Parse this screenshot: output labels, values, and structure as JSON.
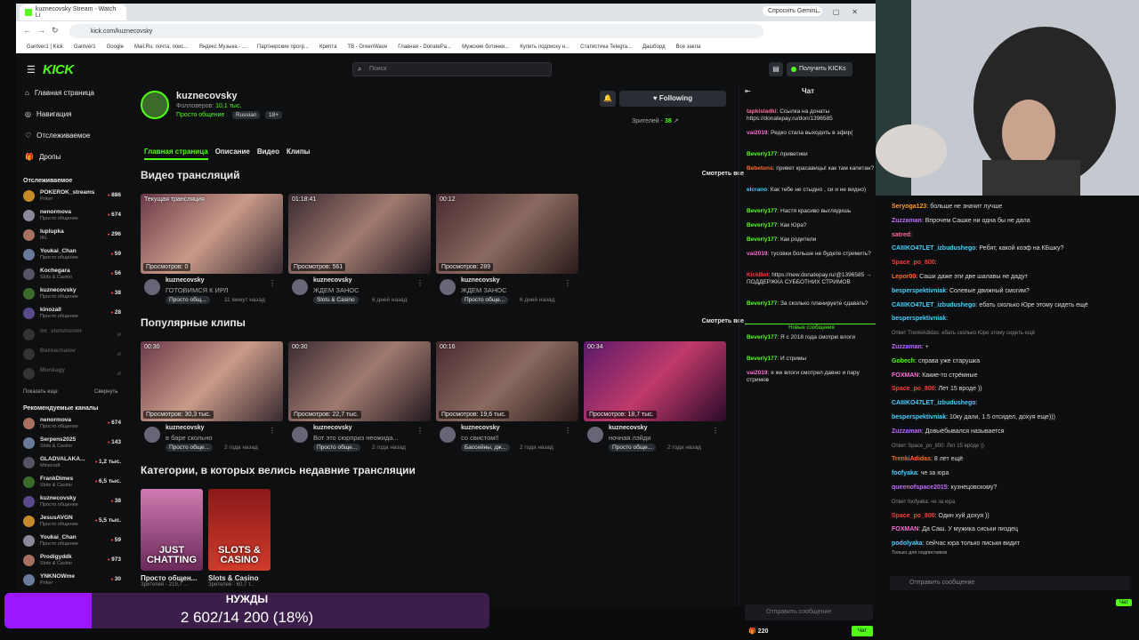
{
  "browser": {
    "tab_title": "kuznecovsky Stream - Watch Li",
    "gemini": "Спросить Gemini",
    "url": "kick.com/kuznecovsky",
    "bookmarks": [
      "Gantver1 | Kick",
      "Gantver1",
      "Google",
      "Mail.Ru: почта, поис...",
      "Яндекс Музыка - ...",
      "Партнерские прогр...",
      "Крипта",
      "TB - GreenWave",
      "Главная - DonatePa...",
      "Мужские ботинки...",
      "Купить подписку н...",
      "Статистика Telegra...",
      "Дашборд",
      "Все закла"
    ]
  },
  "kick": {
    "search_placeholder": "Поиск",
    "kicks_button": "Получить KICKs",
    "nav": [
      {
        "label": "Главная страница",
        "icon": "home-icon"
      },
      {
        "label": "Навигация",
        "icon": "compass-icon"
      },
      {
        "label": "Отслеживаемое",
        "icon": "heart-icon"
      },
      {
        "label": "Дропы",
        "icon": "gift-icon"
      }
    ],
    "followed_title": "Отслеживаемое",
    "followed": [
      {
        "name": "POKEROK_streams",
        "cat": "Poker",
        "viewers": "886"
      },
      {
        "name": "nenormova",
        "cat": "Просто общение",
        "viewers": "674"
      },
      {
        "name": "luplupka",
        "cat": "IRL",
        "viewers": "296"
      },
      {
        "name": "Youkai_Chan",
        "cat": "Просто общение",
        "viewers": "59"
      },
      {
        "name": "Kochegara",
        "cat": "Slots & Casino",
        "viewers": "56"
      },
      {
        "name": "kuznecovsky",
        "cat": "Просто общение",
        "viewers": "38"
      },
      {
        "name": "kinozall",
        "cat": "Просто общение",
        "viewers": "28"
      }
    ],
    "offline": [
      "mr_slotshunter",
      "Beznachalov",
      "Monkagy"
    ],
    "show_more": "Показать еще",
    "collapse": "Свернуть",
    "recommended_title": "Рекомендуемые каналы",
    "recommended": [
      {
        "name": "nenormova",
        "cat": "Просто общение",
        "viewers": "674"
      },
      {
        "name": "Serpens2025",
        "cat": "Slots & Casino",
        "viewers": "143"
      },
      {
        "name": "GLADVALAKA...",
        "cat": "Minecraft",
        "viewers": "1,2 тыс."
      },
      {
        "name": "FrankDimes",
        "cat": "Slots & Casino",
        "viewers": "6,5 тыс."
      },
      {
        "name": "kuznecovsky",
        "cat": "Просто общение",
        "viewers": "38"
      },
      {
        "name": "JesusAVGN",
        "cat": "Просто общение",
        "viewers": "5,5 тыс."
      },
      {
        "name": "Youkai_Chan",
        "cat": "Просто общение",
        "viewers": "59"
      },
      {
        "name": "Prodigyddk",
        "cat": "Slots & Casino",
        "viewers": "973"
      },
      {
        "name": "YNKNOWme",
        "cat": "Poker",
        "viewers": "30"
      }
    ],
    "profile": {
      "name": "kuznecovsky",
      "followers_label": "Фолловеров:",
      "followers": "10,1 тыс.",
      "category": "Просто общение",
      "lang": "Russian",
      "age": "18+",
      "follow_btn": "Following",
      "viewers_label": "Зрителей -",
      "viewers": "38"
    },
    "tabs": [
      "Главная страница",
      "Описание",
      "Видео",
      "Клипы"
    ],
    "videos_title": "Видео трансляций",
    "see_all": "Смотреть все",
    "videos": [
      {
        "dur": "Текущая трансляция",
        "views": "Просмотров: 0",
        "name": "kuznecovsky",
        "title": "ГОТОВИМСЯ К ИРЛ",
        "tag": "Просто общ...",
        "ago": "11 минут назад"
      },
      {
        "dur": "01:18:41",
        "views": "Просмотров: 561",
        "name": "kuznecovsky",
        "title": "ЖДЕМ ЗАНОС",
        "tag": "Slots & Casino",
        "ago": "6 дней назад"
      },
      {
        "dur": "00:12",
        "views": "Просмотров: 289",
        "name": "kuznecovsky",
        "title": "ЖДЕМ ЗАНОС",
        "tag": "Просто обще...",
        "ago": "6 дней назад"
      }
    ],
    "clips_title": "Популярные клипы",
    "clips": [
      {
        "dur": "00:30",
        "views": "Просмотров: 30,3 тыс.",
        "name": "kuznecovsky",
        "title": "в баре скольно",
        "tag": "Просто обще...",
        "ago": "2 года назад"
      },
      {
        "dur": "00:30",
        "views": "Просмотров: 22,7 тыс.",
        "name": "kuznecovsky",
        "title": "Вот это сюрприз неожида...",
        "tag": "Просто обще...",
        "ago": "2 года назад"
      },
      {
        "dur": "00:16",
        "views": "Просмотров: 19,6 тыс.",
        "name": "kuznecovsky",
        "title": "со свистом!!",
        "tag": "Бассейны, дж...",
        "ago": "2 года назад"
      },
      {
        "dur": "00:34",
        "views": "Просмотров: 18,7 тыс.",
        "name": "kuznecovsky",
        "title": "ночная лэйди",
        "tag": "Просто обще...",
        "ago": "2 года назад"
      }
    ],
    "categories_title": "Категории, в которых велись недавние трансляции",
    "categories": [
      {
        "img": "JUST CHATTING",
        "name": "Просто общен...",
        "view": "Зрителей - 219,7 ..."
      },
      {
        "img": "SLOTS & CASINO",
        "name": "Slots & Casino",
        "view": "Зрителей - 60,7 т..."
      }
    ],
    "chat": {
      "title": "Чат",
      "messages": [
        {
          "u": "tapkisladki",
          "c": "#ff6b9a",
          "t": "Ссылка на донаты https://donatepay.ru/don/1396585"
        },
        {
          "u": "vai2019",
          "c": "#ff6bd5",
          "t": "Редко стала выходить в эфир("
        },
        {
          "u": "Beverly177",
          "c": "#53fc18",
          "t": "приветики"
        },
        {
          "u": "Bebetons",
          "c": "#ff6b2a",
          "t": "привет красавицы! как там капитан?"
        },
        {
          "u": "elcrano",
          "c": "#47d1ff",
          "t": "Как тебе не стыдно , си и не видно)"
        },
        {
          "u": "Beverly177",
          "c": "#53fc18",
          "t": "Настя красиво выглядишь"
        },
        {
          "u": "Beverly177",
          "c": "#53fc18",
          "t": "Как Юра?"
        },
        {
          "u": "Beverly177",
          "c": "#53fc18",
          "t": "Как родители"
        },
        {
          "u": "vai2019",
          "c": "#ff6bd5",
          "t": "тусовки больше не будете стримить?"
        },
        {
          "u": "KickBot",
          "c": "#ff3b3b",
          "t": "https://new.donatepay.ru/@1396585 → ПОДДЕРЖКА СУББОТНИХ СТРИМОВ"
        },
        {
          "u": "Beverly177",
          "c": "#53fc18",
          "t": "За сколько планируете сдавать?"
        }
      ],
      "new_label": "Новые сообщения",
      "messages2": [
        {
          "u": "Beverly177",
          "c": "#53fc18",
          "t": "Я с 2018 года смотрю влоги"
        },
        {
          "u": "Beverly177",
          "c": "#53fc18",
          "t": "И стримы"
        },
        {
          "u": "vai2019",
          "c": "#ff6bd5",
          "t": "я же влоги смотрел давно и пару стримов"
        }
      ],
      "input": "Отправить сообщение",
      "count": "220",
      "send": "Чат"
    }
  },
  "right_chat": {
    "messages": [
      {
        "u": "Seryoga123",
        "c": "#ff9b2a",
        "t": "больше не значит лучше"
      },
      {
        "u": "Zuzzaman",
        "c": "#c06bff",
        "t": "Впрочем Сашке ни одна бы не дала"
      },
      {
        "u": "satred",
        "c": "#ff6b9a",
        "t": ""
      },
      {
        "u": "CAIIIKO47LET_izbudushego",
        "c": "#47d1ff",
        "t": "Ребят, какой коэф на КБшку?"
      },
      {
        "u": "Space_po_800",
        "c": "#ff3b3b",
        "t": ""
      },
      {
        "u": "Lepor00",
        "c": "#ff6b2a",
        "t": "Саши даже эти две шалавы не дадут"
      },
      {
        "u": "besperspektivniak",
        "c": "#47d1ff",
        "t": "Солевые движный смогим?"
      },
      {
        "u": "CAIIIKO47LET_izbudushego",
        "c": "#47d1ff",
        "t": "ебать сколько Юре этому сидеть ещё"
      },
      {
        "u": "besperspektivniak",
        "c": "#47d1ff",
        "t": ""
      },
      {
        "u": "",
        "c": "#888",
        "t": "Ответ TrenkiAdidas: ебать сколько Юре этому сидеть ещё"
      },
      {
        "u": "Zuzzaman",
        "c": "#c06bff",
        "t": "+"
      },
      {
        "u": "Gobech",
        "c": "#53fc18",
        "t": "справа уже старушка"
      },
      {
        "u": "FOXMAN",
        "c": "#ff6bd5",
        "t": "Какие-то стрёмные"
      },
      {
        "u": "Space_po_800",
        "c": "#ff3b3b",
        "t": "Лет 15 вроде ))"
      },
      {
        "u": "CAIIIKO47LET_izbudushego",
        "c": "#47d1ff",
        "t": ""
      },
      {
        "u": "besperspektivniak",
        "c": "#47d1ff",
        "t": "10ку дали, 1.5 отсидел, дохуя еще)))"
      },
      {
        "u": "Zuzzaman",
        "c": "#c06bff",
        "t": "Довыёбывался называется"
      },
      {
        "u": "",
        "c": "#888",
        "t": "Ответ Space_po_800: Лет 15 вроде ))"
      },
      {
        "u": "TrenkiAdidas",
        "c": "#ff6b2a",
        "t": "8 лет ещё"
      },
      {
        "u": "foofyaka",
        "c": "#47d1ff",
        "t": "че за юра"
      },
      {
        "u": "queenofspace2015",
        "c": "#c06bff",
        "t": "кузнецовскому?"
      },
      {
        "u": "",
        "c": "#888",
        "t": "Ответ foofyaka: че за юра"
      },
      {
        "u": "Space_po_800",
        "c": "#ff3b3b",
        "t": "Один хуй дохуя ))"
      },
      {
        "u": "FOXMAN",
        "c": "#ff6bd5",
        "t": "Да Саш. У мужика сиськи пиздец"
      },
      {
        "u": "podolyaka",
        "c": "#47d1ff",
        "t": "сейчас юра только письки видит"
      }
    ],
    "subs_only": "Только для подписчиков",
    "input": "Отправить сообщение",
    "send": "Чат"
  },
  "donation": {
    "title": "НУЖДЫ",
    "value": "2 602/14 200 (18%)",
    "progress": 0.18
  }
}
